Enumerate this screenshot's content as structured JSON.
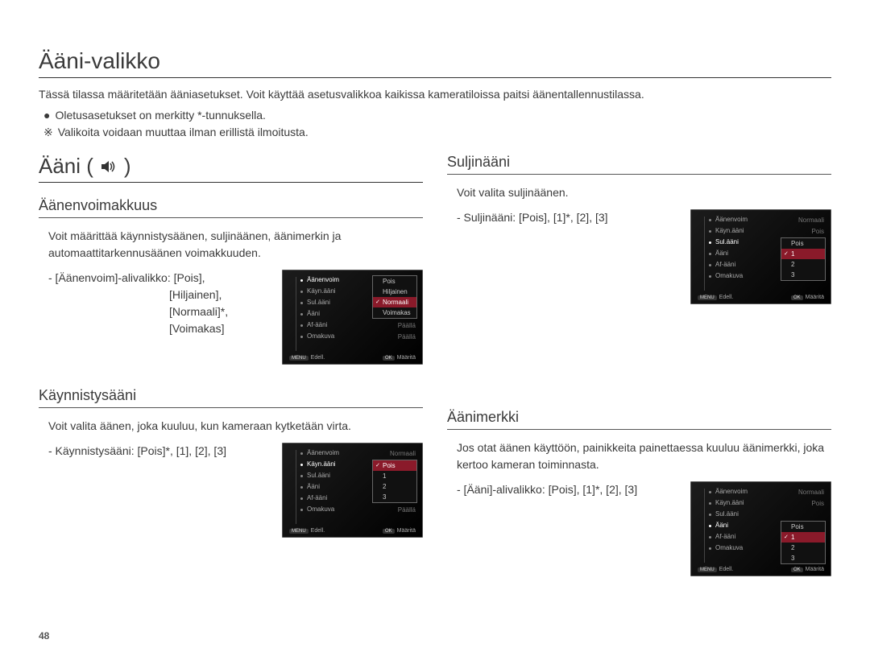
{
  "page_title": "Ääni-valikko",
  "intro": "Tässä tilassa määritetään ääniasetukset. Voit käyttää asetusvalikkoa kaikissa kameratiloissa paitsi äänentallennustilassa.",
  "bullets": {
    "b1_prefix": "●",
    "b1": "Oletusasetukset on merkitty *-tunnuksella.",
    "b2_prefix": "※",
    "b2": "Valikoita voidaan muuttaa ilman erillistä ilmoitusta."
  },
  "sound_heading": "Ääni (",
  "sound_heading_close": ")",
  "page_number": "48",
  "left": {
    "volume": {
      "heading": "Äänenvoimakkuus",
      "body": "Voit määrittää käynnistysäänen, suljinäänen, äänimerkin ja automaattitarkennusäänen voimakkuuden.",
      "opt_line1": "- [Äänenvoim]-alivalikko: [Pois],",
      "opt_line2": "[Hiljainen],",
      "opt_line3": "[Normaali]*,",
      "opt_line4": "[Voimakas]"
    },
    "startup": {
      "heading": "Käynnistysääni",
      "body": "Voit valita äänen, joka kuuluu, kun kameraan kytketään virta.",
      "opt_line1": "- Käynnistysääni: [Pois]*, [1], [2], [3]"
    }
  },
  "right": {
    "shutter": {
      "heading": "Suljinääni",
      "body": "Voit valita suljinäänen.",
      "opt_line1": "- Suljinääni: [Pois], [1]*, [2], [3]"
    },
    "beep": {
      "heading": "Äänimerkki",
      "body": "Jos otat äänen käyttöön, painikkeita painettaessa kuuluu äänimerkki, joka kertoo kameran toiminnasta.",
      "opt_line1": "- [Ääni]-alivalikko: [Pois], [1]*, [2], [3]"
    }
  },
  "menu_labels": {
    "items": [
      "Äänenvoim",
      "Käyn.ääni",
      "Sul.ääni",
      "Ääni",
      "Af-ääni",
      "Omakuva"
    ],
    "top_right_normal": "Normaali",
    "top_right_pois": "Pois",
    "top_right_paalla": "Päällä",
    "footer_back_btn": "MENU",
    "footer_back": "Edell.",
    "footer_ok_btn": "OK",
    "footer_ok": "Määritä"
  },
  "submenus": {
    "volume": {
      "items": [
        "Pois",
        "Hiljainen",
        "Normaali",
        "Voimakas"
      ],
      "selected": 2,
      "checked": 2
    },
    "startup": {
      "items": [
        "Pois",
        "1",
        "2",
        "3"
      ],
      "selected": 0,
      "checked": 0
    },
    "shutter": {
      "items": [
        "Pois",
        "1",
        "2",
        "3"
      ],
      "selected": 1,
      "checked": 1
    },
    "beep": {
      "items": [
        "Pois",
        "1",
        "2",
        "3"
      ],
      "selected": 1,
      "checked": 1
    }
  }
}
